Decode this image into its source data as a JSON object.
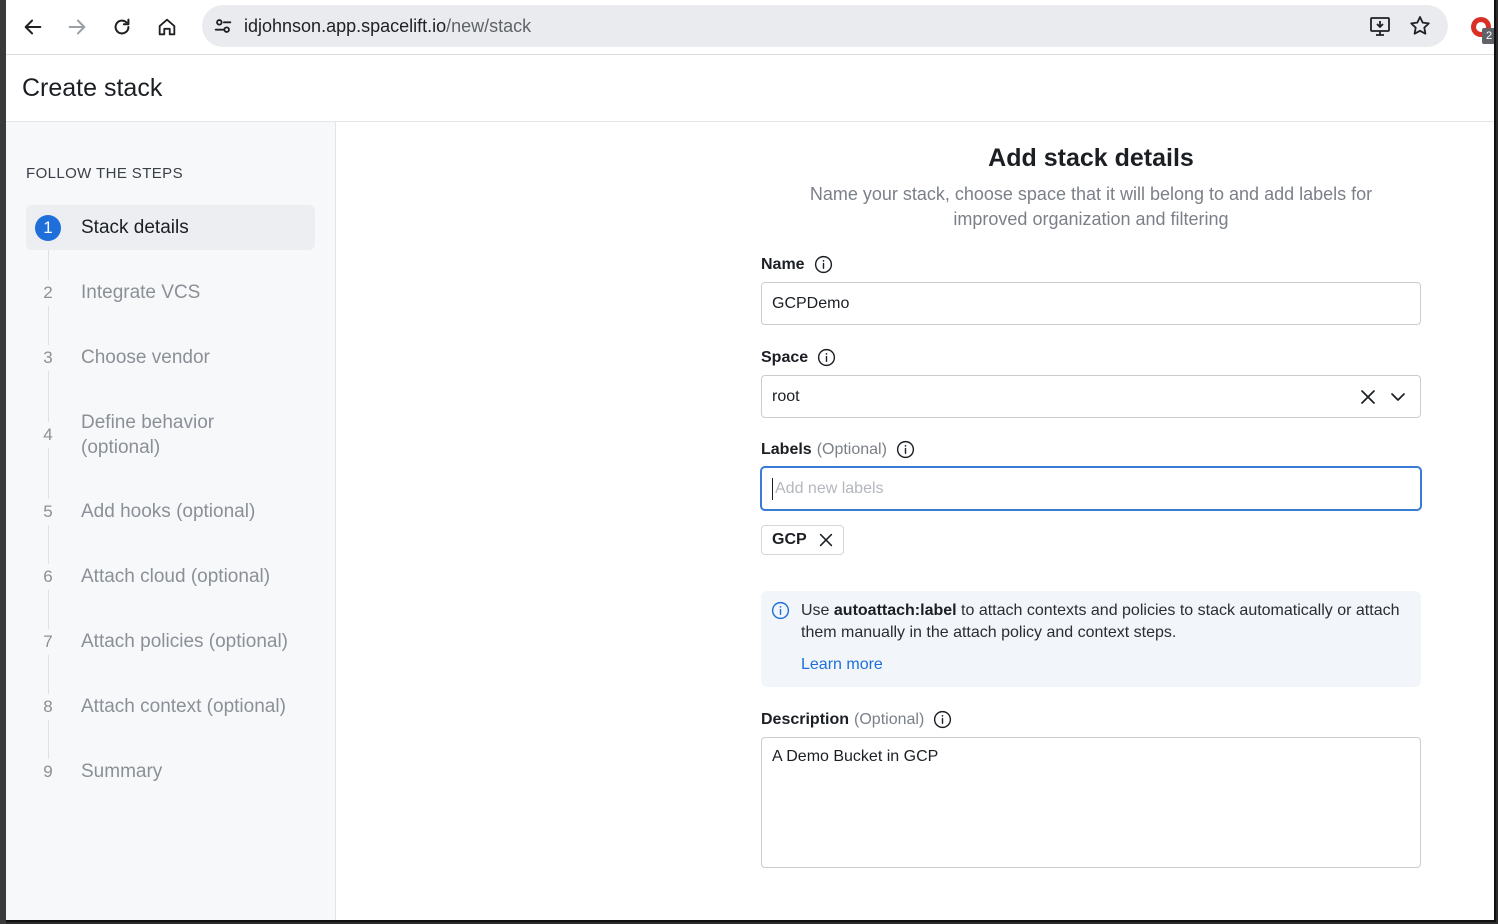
{
  "browser": {
    "url_host": "idjohnson.app.spacelift.io",
    "url_path": "/new/stack",
    "extension_badge": "2"
  },
  "page": {
    "title": "Create stack"
  },
  "sidebar": {
    "heading": "FOLLOW THE STEPS",
    "steps": [
      {
        "num": "1",
        "label": "Stack details",
        "active": true
      },
      {
        "num": "2",
        "label": "Integrate VCS"
      },
      {
        "num": "3",
        "label": "Choose vendor"
      },
      {
        "num": "4",
        "label": "Define behavior (optional)"
      },
      {
        "num": "5",
        "label": "Add hooks (optional)"
      },
      {
        "num": "6",
        "label": "Attach cloud (optional)"
      },
      {
        "num": "7",
        "label": "Attach policies (optional)"
      },
      {
        "num": "8",
        "label": "Attach context (optional)"
      },
      {
        "num": "9",
        "label": "Summary"
      }
    ]
  },
  "form": {
    "title": "Add stack details",
    "subtitle": "Name your stack, choose space that it will belong to and add labels for improved organization and filtering",
    "name": {
      "label": "Name",
      "value": "GCPDemo"
    },
    "space": {
      "label": "Space",
      "value": "root"
    },
    "labels": {
      "label": "Labels",
      "optional": "(Optional)",
      "placeholder": "Add new labels",
      "tags": [
        "GCP"
      ]
    },
    "callout": {
      "prefix": "Use ",
      "keyword": "autoattach:label",
      "suffix": " to attach contexts and policies to stack automatically or attach them manually in the attach policy and context steps.",
      "link": "Learn more"
    },
    "description": {
      "label": "Description",
      "optional": "(Optional)",
      "value": "A Demo Bucket in GCP"
    }
  },
  "colors": {
    "accent": "#1e6fd9",
    "sidebar_bg": "#f7f8fa",
    "callout_bg": "#f2f6fa"
  }
}
